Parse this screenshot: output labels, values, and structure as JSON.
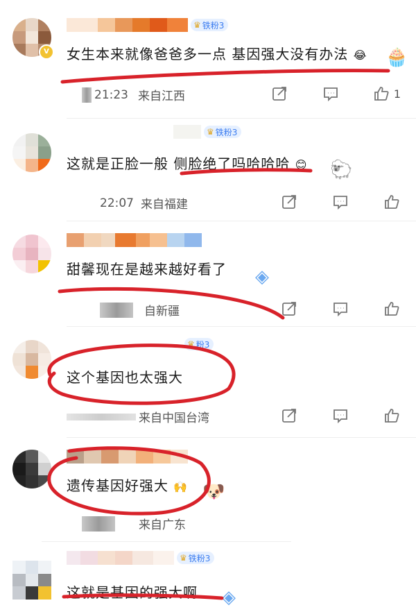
{
  "comments": [
    {
      "text": "女生本来就像爸爸多一点 基因强大没有办法",
      "time": "21:23",
      "location": "来自江西",
      "fan_level": "铁粉3",
      "likes": "1"
    },
    {
      "text": "这就是正脸一般 侧脸绝了吗哈哈哈",
      "time": "22:07",
      "location": "来自福建",
      "fan_level": "铁粉3"
    },
    {
      "text": "甜馨现在是越来越好看了",
      "location": "自新疆"
    },
    {
      "text": "这个基因也太强大",
      "location": "来自中国台湾",
      "fan_level": "粉3"
    },
    {
      "text": "遗传基因好强大",
      "location": "来自广东"
    },
    {
      "text": "这就是基因的强大啊",
      "fan_level": "铁粉3"
    }
  ],
  "colors": {
    "annotation": "#d8222a",
    "fan_badge_bg": "#e6f0ff",
    "fan_badge_text": "#3b7cf0"
  },
  "icons": [
    "repost-icon",
    "comment-icon",
    "like-icon"
  ]
}
